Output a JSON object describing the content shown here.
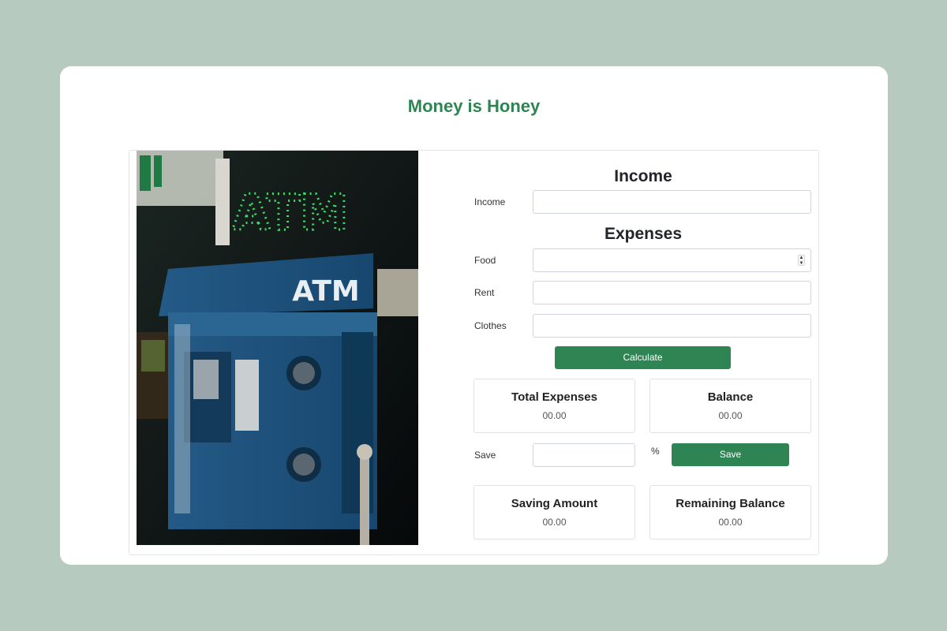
{
  "app": {
    "title": "Money is Honey"
  },
  "photo": {
    "sign_text": "ATM",
    "machine_text": "ATM"
  },
  "income": {
    "heading": "Income",
    "label": "Income",
    "value": ""
  },
  "expenses": {
    "heading": "Expenses",
    "food_label": "Food",
    "food_value": "",
    "rent_label": "Rent",
    "rent_value": "",
    "clothes_label": "Clothes",
    "clothes_value": ""
  },
  "calculate_label": "Calculate",
  "totals": {
    "total_expenses_title": "Total Expenses",
    "total_expenses_value": "00.00",
    "balance_title": "Balance",
    "balance_value": "00.00"
  },
  "save": {
    "label": "Save",
    "value": "",
    "percent_sign": "%",
    "button_label": "Save"
  },
  "savings": {
    "saving_amount_title": "Saving Amount",
    "saving_amount_value": "00.00",
    "remaining_balance_title": "Remaining Balance",
    "remaining_balance_value": "00.00"
  },
  "colors": {
    "accent": "#2f8454",
    "page_bg": "#b7cabf",
    "card_bg": "#ffffff"
  }
}
